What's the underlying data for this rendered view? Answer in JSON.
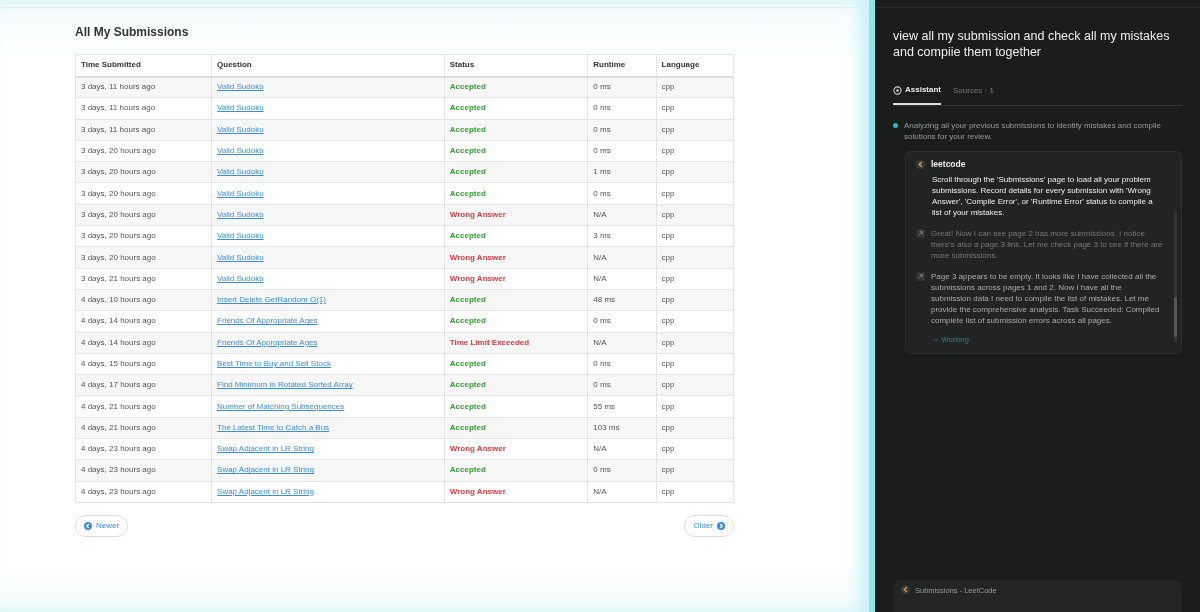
{
  "page_title": "All My Submissions",
  "table": {
    "columns": [
      "Time Submitted",
      "Question",
      "Status",
      "Runtime",
      "Language"
    ],
    "rows": [
      {
        "time": "3 days, 11 hours ago",
        "question": "Valid Sudoku",
        "status": "Accepted",
        "kind": "accepted",
        "runtime": "0 ms",
        "language": "cpp"
      },
      {
        "time": "3 days, 11 hours ago",
        "question": "Valid Sudoku",
        "status": "Accepted",
        "kind": "accepted",
        "runtime": "0 ms",
        "language": "cpp"
      },
      {
        "time": "3 days, 11 hours ago",
        "question": "Valid Sudoku",
        "status": "Accepted",
        "kind": "accepted",
        "runtime": "0 ms",
        "language": "cpp"
      },
      {
        "time": "3 days, 20 hours ago",
        "question": "Valid Sudoku",
        "status": "Accepted",
        "kind": "accepted",
        "runtime": "0 ms",
        "language": "cpp"
      },
      {
        "time": "3 days, 20 hours ago",
        "question": "Valid Sudoku",
        "status": "Accepted",
        "kind": "accepted",
        "runtime": "1 ms",
        "language": "cpp"
      },
      {
        "time": "3 days, 20 hours ago",
        "question": "Valid Sudoku",
        "status": "Accepted",
        "kind": "accepted",
        "runtime": "0 ms",
        "language": "cpp"
      },
      {
        "time": "3 days, 20 hours ago",
        "question": "Valid Sudoku",
        "status": "Wrong Answer",
        "kind": "failed",
        "runtime": "N/A",
        "language": "cpp"
      },
      {
        "time": "3 days, 20 hours ago",
        "question": "Valid Sudoku",
        "status": "Accepted",
        "kind": "accepted",
        "runtime": "3 ms",
        "language": "cpp"
      },
      {
        "time": "3 days, 20 hours ago",
        "question": "Valid Sudoku",
        "status": "Wrong Answer",
        "kind": "failed",
        "runtime": "N/A",
        "language": "cpp"
      },
      {
        "time": "3 days, 21 hours ago",
        "question": "Valid Sudoku",
        "status": "Wrong Answer",
        "kind": "failed",
        "runtime": "N/A",
        "language": "cpp"
      },
      {
        "time": "4 days, 10 hours ago",
        "question": "Insert Delete GetRandom O(1)",
        "status": "Accepted",
        "kind": "accepted",
        "runtime": "48 ms",
        "language": "cpp"
      },
      {
        "time": "4 days, 14 hours ago",
        "question": "Friends Of Appropriate Ages",
        "status": "Accepted",
        "kind": "accepted",
        "runtime": "0 ms",
        "language": "cpp"
      },
      {
        "time": "4 days, 14 hours ago",
        "question": "Friends Of Appropriate Ages",
        "status": "Time Limit Exceeded",
        "kind": "failed",
        "runtime": "N/A",
        "language": "cpp"
      },
      {
        "time": "4 days, 15 hours ago",
        "question": "Best Time to Buy and Sell Stock",
        "status": "Accepted",
        "kind": "accepted",
        "runtime": "0 ms",
        "language": "cpp"
      },
      {
        "time": "4 days, 17 hours ago",
        "question": "Find Minimum in Rotated Sorted Array",
        "status": "Accepted",
        "kind": "accepted",
        "runtime": "0 ms",
        "language": "cpp"
      },
      {
        "time": "4 days, 21 hours ago",
        "question": "Number of Matching Subsequences",
        "status": "Accepted",
        "kind": "accepted",
        "runtime": "55 ms",
        "language": "cpp"
      },
      {
        "time": "4 days, 21 hours ago",
        "question": "The Latest Time to Catch a Bus",
        "status": "Accepted",
        "kind": "accepted",
        "runtime": "103 ms",
        "language": "cpp"
      },
      {
        "time": "4 days, 23 hours ago",
        "question": "Swap Adjacent in LR String",
        "status": "Wrong Answer",
        "kind": "failed",
        "runtime": "N/A",
        "language": "cpp"
      },
      {
        "time": "4 days, 23 hours ago",
        "question": "Swap Adjacent in LR String",
        "status": "Accepted",
        "kind": "accepted",
        "runtime": "0 ms",
        "language": "cpp"
      },
      {
        "time": "4 days, 23 hours ago",
        "question": "Swap Adjacent in LR String",
        "status": "Wrong Answer",
        "kind": "failed",
        "runtime": "N/A",
        "language": "cpp"
      }
    ]
  },
  "pager": {
    "newer": "Newer",
    "older": "Older"
  },
  "assistant": {
    "query": "view all my submission and check all my mistakes and compiie them together",
    "tabs": [
      {
        "label": "Assistant",
        "selected": true
      },
      {
        "label": "Sources · 1",
        "selected": false
      }
    ],
    "status_line": "Analyzing all your previous submissions to identify mistakes and compile solutions for your review.",
    "task": {
      "site": "leetcode",
      "instruction": "Scroll through the 'Submissions' page to load all your problem submissions. Record details for every submission with 'Wrong Answer', 'Compile Error', or 'Runtime Error' status to compile a list of your mistakes.",
      "steps": [
        "Great! Now I can see page 2 has more submissions. I notice there's also a page 3 link. Let me check page 3 to see if there are more submissions.",
        "Page 3 appears to be empty. It looks like I have collected all the submissions across pages 1 and 2. Now I have all the submission data I need to compile the list of mistakes. Let me provide the comprehensive analysis. Task Succeeded: Compiled complete list of submission errors across all pages."
      ],
      "working": "⇔ Working"
    },
    "tab_chip": "Submissions - LeetCode"
  }
}
